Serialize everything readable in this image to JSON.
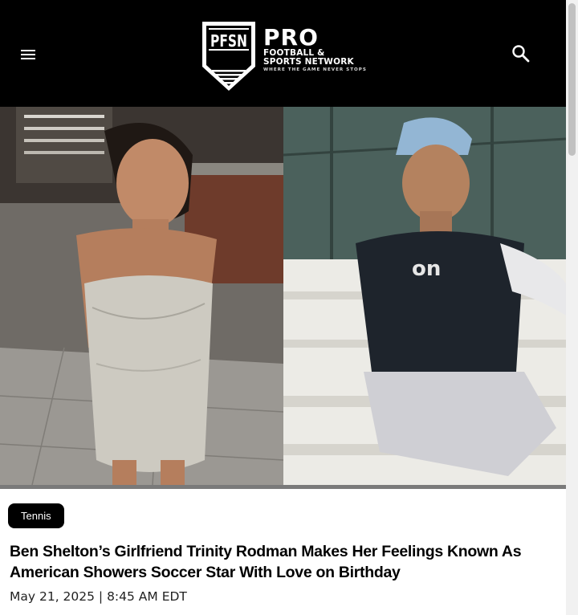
{
  "header": {
    "menu_icon": "hamburger-menu-icon",
    "search_icon": "search-icon",
    "logo": {
      "monogram": "PFSN",
      "title": "PRO",
      "line1": "FOOTBALL &",
      "line2": "SPORTS NETWORK",
      "tagline": "WHERE THE GAME NEVER STOPS"
    },
    "background": "#000000"
  },
  "article": {
    "category": "Tennis",
    "headline": "Ben Shelton’s Girlfriend Trinity Rodman Makes Her Feelings Known As American Showers Soccer Star With Love on Birthday",
    "date": "May 21, 2025 | 8:45 AM EDT"
  },
  "colors": {
    "header_bg": "#000000",
    "pill_bg": "#000000",
    "text": "#000000"
  }
}
